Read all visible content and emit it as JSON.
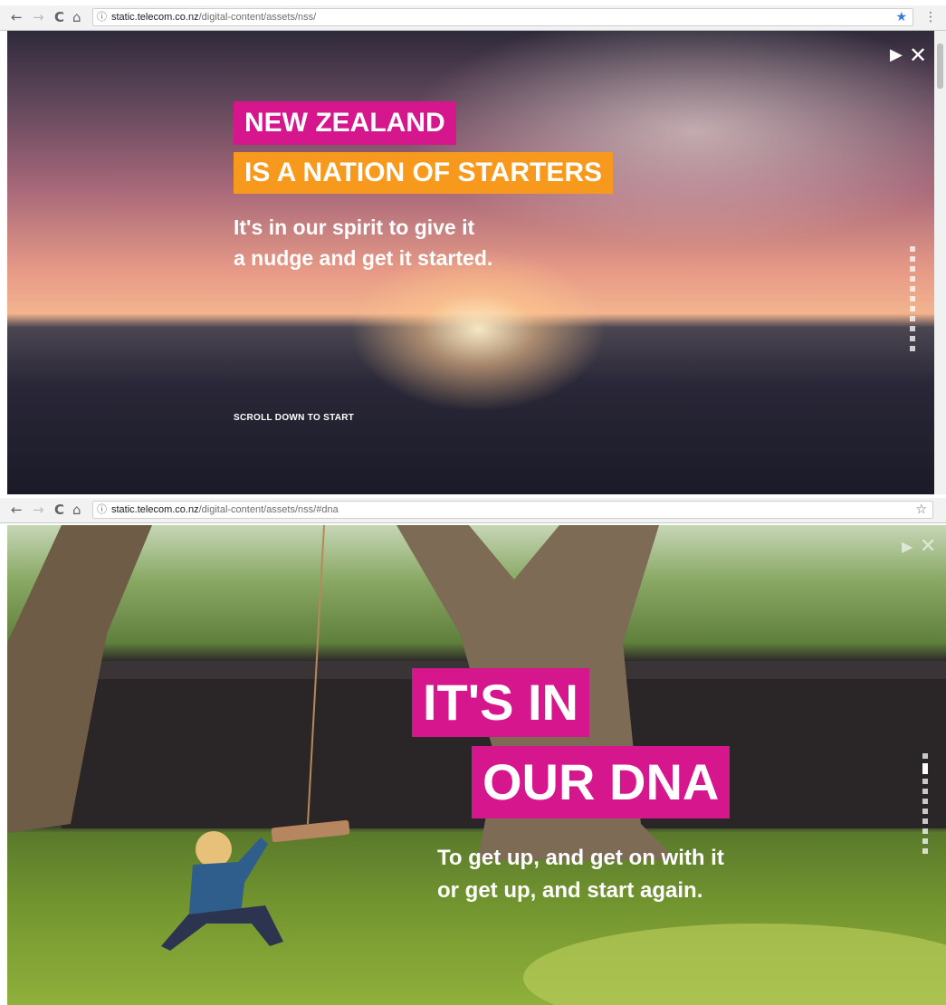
{
  "top": {
    "browser": {
      "back_icon": "←",
      "forward_icon": "→",
      "reload_icon": "C",
      "home_icon": "⌂",
      "info_icon": "ⓘ",
      "url_host": "static.telecom.co.nz",
      "url_path": "/digital-content/assets/nss/",
      "star_icon": "★",
      "menu_icon": "⋮"
    },
    "hero": {
      "headline_line1": "NEW ZEALAND",
      "headline_line2": "IS A NATION OF STARTERS",
      "subtext_line1": "It's in our spirit to give it",
      "subtext_line2": "a nudge and get it started.",
      "scroll_prompt": "SCROLL DOWN TO START",
      "play_icon": "▶",
      "close_icon": "✕"
    }
  },
  "bottom": {
    "browser": {
      "back_icon": "←",
      "forward_icon": "→",
      "reload_icon": "C",
      "home_icon": "⌂",
      "info_icon": "ⓘ",
      "url_host": "static.telecom.co.nz",
      "url_path": "/digital-content/assets/nss/#dna",
      "star_icon": "☆"
    },
    "hero": {
      "headline_line1": "IT'S IN",
      "headline_line2": "OUR DNA",
      "subtext_line1": "To get up, and get on with it",
      "subtext_line2": "or get up, and start again.",
      "play_icon": "▶",
      "close_icon": "✕"
    }
  },
  "colors": {
    "magenta": "#d6168c",
    "orange": "#f7991c"
  }
}
